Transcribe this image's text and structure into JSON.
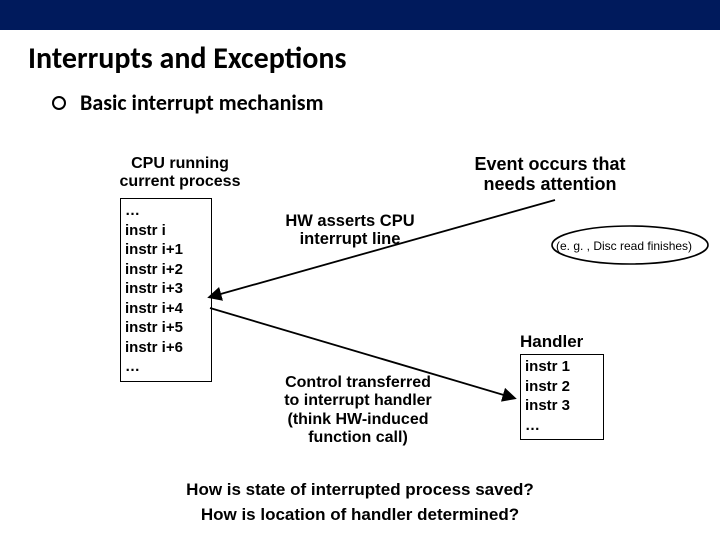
{
  "title": "Interrupts and Exceptions",
  "bullet": "Basic interrupt mechanism",
  "cpu": {
    "title": "CPU running\ncurrent process",
    "instrs": [
      "…",
      "instr i",
      "instr i+1",
      "instr i+2",
      "instr i+3",
      "instr i+4",
      "instr i+5",
      "instr i+6",
      "…"
    ]
  },
  "event": "Event occurs that\nneeds attention",
  "hw": "HW asserts CPU\ninterrupt line",
  "eg": "(e. g. , Disc read finishes)",
  "handler": {
    "label": "Handler",
    "instrs": [
      "instr 1",
      "instr 2",
      "instr 3",
      "…"
    ]
  },
  "ctrl": "Control transferred\nto interrupt handler\n(think HW-induced\nfunction call)",
  "q1": "How is state of interrupted process saved?",
  "q2": "How is location of handler determined?"
}
